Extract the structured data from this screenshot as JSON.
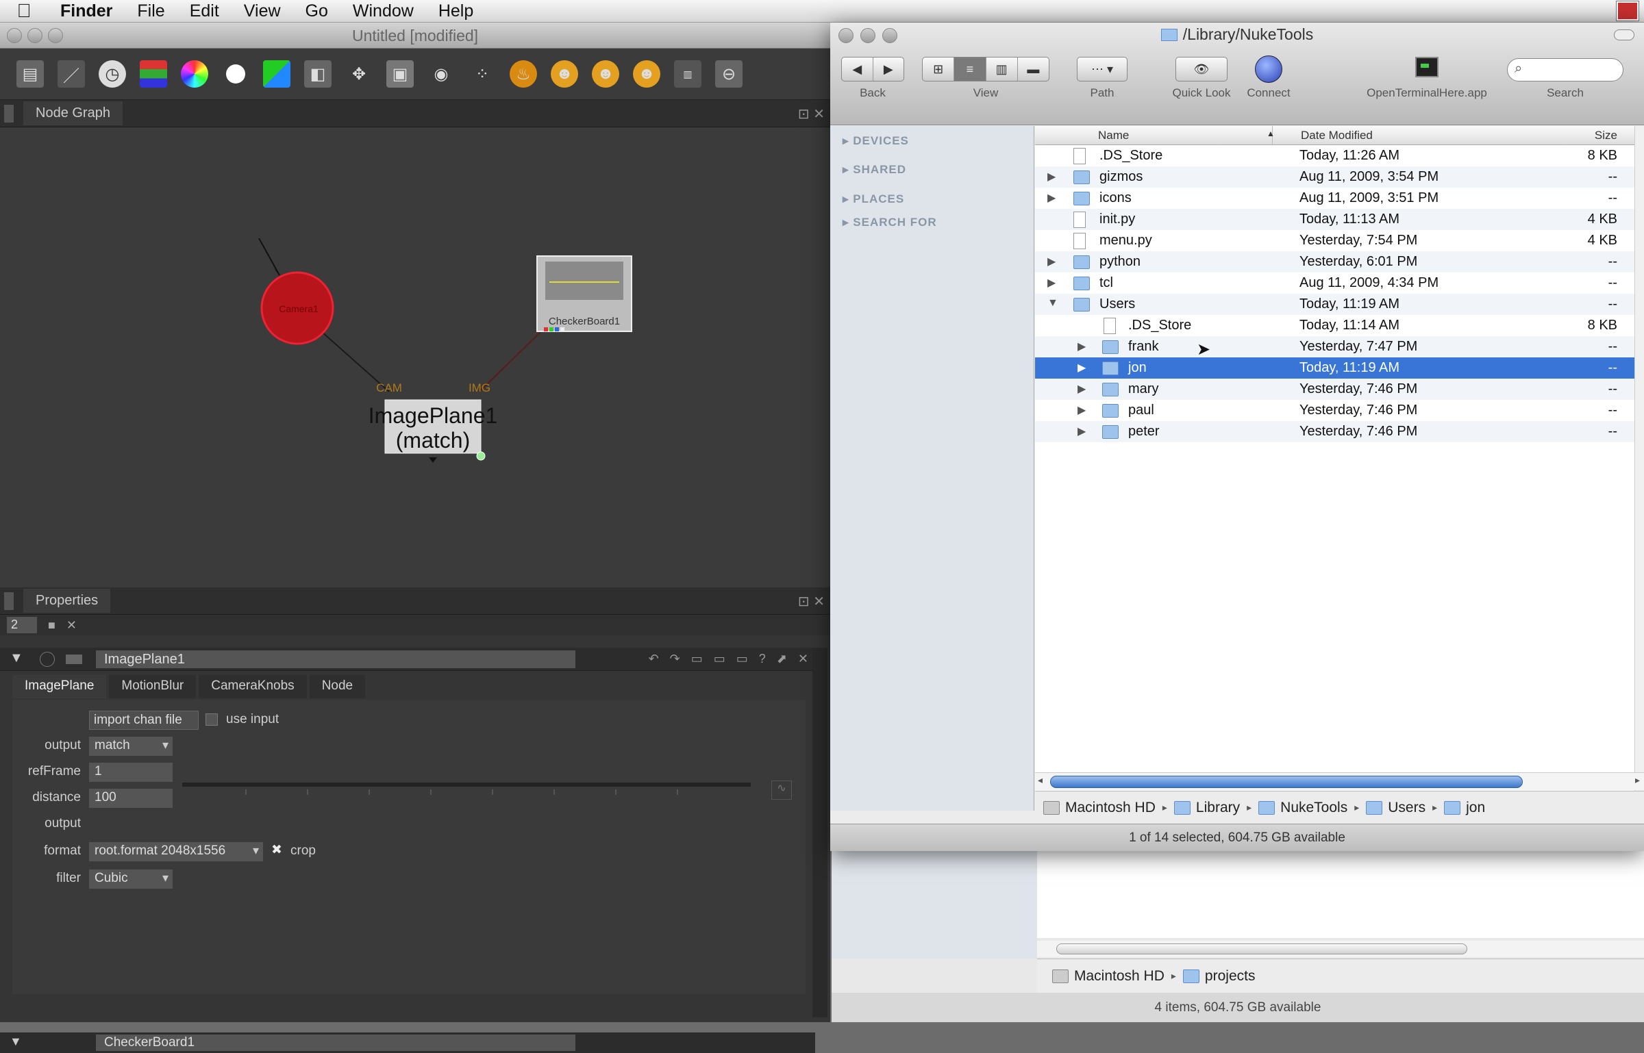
{
  "menubar": {
    "app": "Finder",
    "items": [
      "File",
      "Edit",
      "View",
      "Go",
      "Window",
      "Help"
    ]
  },
  "nuke": {
    "title": "Untitled [modified]",
    "node_graph_tab": "Node Graph",
    "properties_tab": "Properties",
    "properties_count": "2",
    "nodes": {
      "camera": "Camera1",
      "checkerboard": "CheckerBoard1",
      "imageplane_line1": "ImagePlane1",
      "imageplane_line2": "(match)",
      "input_cam": "CAM",
      "input_img": "IMG"
    },
    "imageplane_node": {
      "name": "ImagePlane1",
      "tabs": [
        "ImagePlane",
        "MotionBlur",
        "CameraKnobs",
        "Node"
      ],
      "import_button": "import chan file",
      "use_input": "use input",
      "output_label": "output",
      "output_value": "match",
      "refframe_label": "refFrame",
      "refframe_value": "1",
      "distance_label": "distance",
      "distance_value": "100",
      "output2_label": "output",
      "format_label": "format",
      "format_value": "root.format 2048x1556",
      "crop_label": "crop",
      "filter_label": "filter",
      "filter_value": "Cubic"
    },
    "checkerboard_node_name": "CheckerBoard1"
  },
  "finder": {
    "title": "/Library/NukeTools",
    "toolbar": {
      "back": "Back",
      "view": "View",
      "path": "Path",
      "quicklook": "Quick Look",
      "connect": "Connect",
      "app": "OpenTerminalHere.app",
      "search": "Search"
    },
    "sidebar": [
      "DEVICES",
      "SHARED",
      "PLACES",
      "SEARCH FOR"
    ],
    "columns": {
      "name": "Name",
      "date": "Date Modified",
      "size": "Size"
    },
    "rows": [
      {
        "name": ".DS_Store",
        "date": "Today, 11:26 AM",
        "size": "8 KB"
      },
      {
        "name": "gizmos",
        "date": "Aug 11, 2009, 3:54 PM",
        "size": "--"
      },
      {
        "name": "icons",
        "date": "Aug 11, 2009, 3:51 PM",
        "size": "--"
      },
      {
        "name": "init.py",
        "date": "Today, 11:13 AM",
        "size": "4 KB"
      },
      {
        "name": "menu.py",
        "date": "Yesterday, 7:54 PM",
        "size": "4 KB"
      },
      {
        "name": "python",
        "date": "Yesterday, 6:01 PM",
        "size": "--"
      },
      {
        "name": "tcl",
        "date": "Aug 11, 2009, 4:34 PM",
        "size": "--"
      },
      {
        "name": "Users",
        "date": "Today, 11:19 AM",
        "size": "--"
      },
      {
        "name": ".DS_Store",
        "date": "Today, 11:14 AM",
        "size": "8 KB"
      },
      {
        "name": "frank",
        "date": "Yesterday, 7:47 PM",
        "size": "--"
      },
      {
        "name": "jon",
        "date": "Today, 11:19 AM",
        "size": "--"
      },
      {
        "name": "mary",
        "date": "Yesterday, 7:46 PM",
        "size": "--"
      },
      {
        "name": "paul",
        "date": "Yesterday, 7:46 PM",
        "size": "--"
      },
      {
        "name": "peter",
        "date": "Yesterday, 7:46 PM",
        "size": "--"
      }
    ],
    "path": [
      "Macintosh HD",
      "Library",
      "NukeTools",
      "Users",
      "jon"
    ],
    "status": "1 of 14 selected, 604.75 GB available"
  },
  "finder_back": {
    "path": [
      "Macintosh HD",
      "projects"
    ],
    "status": "4 items, 604.75 GB available"
  }
}
